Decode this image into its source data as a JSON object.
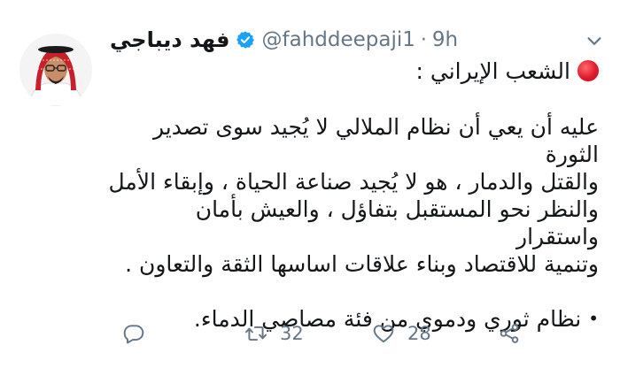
{
  "tweet": {
    "display_name": "فهد ديباجي",
    "handle": "@fahddeepaji1",
    "separator": "·",
    "time": "9h",
    "intro": "الشعب الإيراني :",
    "paragraph": "عليه أن يعي أن نظام الملالي لا يُجيد سوى تصدير الثورة\nوالقتل والدمار ، هو لا يُجيد صناعة الحياة ، وإبقاء الأمل\nوالنظر نحو المستقبل بتفاؤل ، والعيش بأمان واستقرار\nوتنمية للاقتصاد وبناء علاقات اساسها الثقة والتعاون .",
    "bullet_symbol": "•",
    "bullet_text": "نظام ثوري ودموي من فئة مصاصي الدماء.",
    "retweet_count": "32",
    "like_count": "28"
  },
  "icons": {
    "verified": "verified-badge-icon",
    "caret": "chevron-down-icon",
    "reply": "reply-icon",
    "retweet": "retweet-icon",
    "like": "heart-icon",
    "share": "share-icon",
    "red_circle": "red-circle-emoji"
  },
  "colors": {
    "verified_blue": "#1da1f2",
    "muted_text": "#657786",
    "red_circle": "#e0182e"
  }
}
